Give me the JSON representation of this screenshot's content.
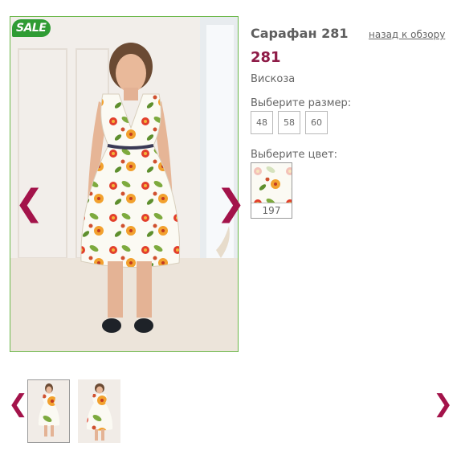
{
  "product": {
    "sale_badge": "SALE",
    "title": "Сарафан 281",
    "back_link": "назад к обзору",
    "price": "281",
    "material": "Вискоза",
    "size_label": "Выберите размер:",
    "sizes": [
      "48",
      "58",
      "60"
    ],
    "color_label": "Выберите цвет:",
    "colors": [
      {
        "code": "197"
      }
    ]
  },
  "gallery": {
    "prev_icon": "chevron-left-icon",
    "next_icon": "chevron-right-icon",
    "prev_glyph": "❮",
    "next_glyph": "❯",
    "thumbnails": [
      {
        "active": true
      },
      {
        "active": false
      }
    ]
  },
  "colors": {
    "accent": "#a3134a",
    "price": "#8e1b47",
    "frame": "#6cb84a",
    "sale": "#2f9c34"
  }
}
